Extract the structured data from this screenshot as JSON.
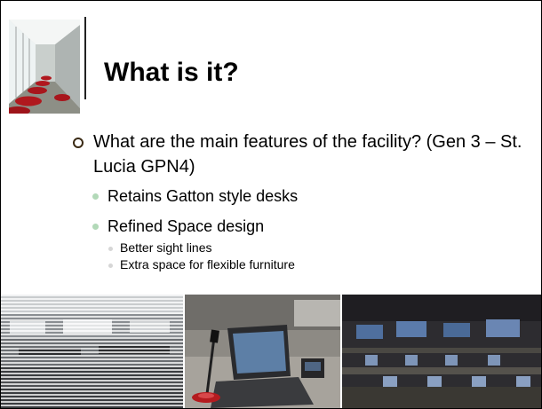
{
  "slide": {
    "title": "What is it?",
    "bullet": "What are the main features of the facility? (Gen 3 – St. Lucia GPN4)",
    "sub_items": [
      {
        "label": "Retains Gatton style desks",
        "children": []
      },
      {
        "label": "Refined Space design",
        "children": [
          "Better sight lines",
          "Extra space for flexible furniture"
        ]
      }
    ],
    "photos": [
      "classroom-photo",
      "desk-microphone-laptop-photo",
      "computer-lab-photo"
    ],
    "colors": {
      "title": "#000000",
      "sub_bullet": "#b2d9b8",
      "accent_red": "#b0181e"
    }
  }
}
